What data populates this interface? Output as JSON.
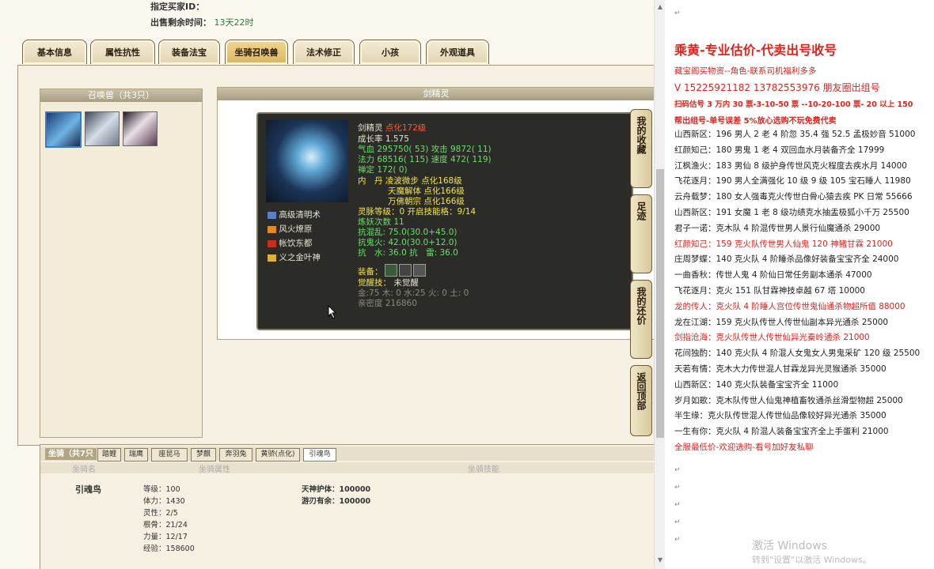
{
  "top": {
    "seller_label": "指定买家ID：",
    "time_label": "出售剩余时间：",
    "time_value": "13天22时"
  },
  "tabs": [
    "基本信息",
    "属性抗性",
    "装备法宝",
    "坐骑召唤兽",
    "法术修正",
    "小孩",
    "外观道具"
  ],
  "summon": {
    "header": "召唤兽（共3只）",
    "detail_header": "剑精灵"
  },
  "tooltip": {
    "name": "剑精灵",
    "level": "点化172级",
    "growth": "成长率 1.575",
    "hp": "气血 295750( 53) 攻击 9872( 11)",
    "mp": "法力 68516( 115) 速度 472( 119)",
    "ding": "禅定 172( 0)",
    "dan1": "内　丹 凌波微步 点化168级",
    "dan2": "天魔解体 点化166级",
    "dan3": "万佛朝宗 点化166级",
    "soul": "灵脉等级：0 开启技能格：9/14",
    "lianyao": "炼妖次数 11",
    "k1": "抗混乱: 75.0(30.0+45.0)",
    "k2": "抗鬼火: 42.0(30.0+12.0)",
    "k3": "抗　水: 36.0 抗　雷: 36.0",
    "equip": "装备：",
    "awaken_label": "觉醒技：",
    "awaken_value": "未觉醒",
    "elements": "金:75 木: 0 水:25 火: 0 土: 0",
    "intimacy": "亲密度 216860",
    "skills": [
      "高级清明术",
      "风火燎原",
      "帐饮东都",
      "义之金叶神"
    ]
  },
  "side_buttons": [
    "我的收藏",
    "足迹",
    "我的还价",
    "返回顶部"
  ],
  "mount": {
    "title": "坐骑（共7只",
    "tabs": [
      "踏鲤",
      "瑞鹰",
      "座昆马",
      "梦麒",
      "奔羽兔",
      "黄骄(点化)",
      "引魂鸟"
    ],
    "col1": "坐骑名",
    "col2": "坐骑属性",
    "col3": "坐骑技能",
    "name": "引魂鸟",
    "attrs": [
      "等级：100",
      "体力：1430",
      "灵性：2/5",
      "根骨：21/24",
      "力量：12/17",
      "经验：158600"
    ],
    "skills": [
      "天神护体：100000",
      "游刃有余：100000"
    ]
  },
  "doc": {
    "title": "乘黄-专业估价-代卖出号收号",
    "line1": "藏宝阁买物资--角色-联系司机福利多多",
    "line2": "V 15225921182   13782553976 朋友圈出组号",
    "line3": "扫码估号 3 万内 30 票-3-10-50 票  --10-20-100 票- 20 以上 150",
    "line4": "帮出组号-单号误差 5%放心选购不玩免费代卖",
    "rows": [
      {
        "t": "山西新区：196 男人 2 老 4 阶忽 35.4 强 52.5 孟极妙音 51000",
        "red": false
      },
      {
        "t": "红颜知己：180 男鬼 1 老 4 双回血水月装备齐全 17999",
        "red": false
      },
      {
        "t": "江枫渔火：183 男仙 8 级护身传世风克火程度去疾水月 14000",
        "red": false
      },
      {
        "t": "飞花逐月：190 男人全满强化 10 级 9 级 105 宝石睡人 11980",
        "red": false
      },
      {
        "t": "云舟载梦：180 女人强毒克火传世白骨心猿去疾 PK 日常 55666",
        "red": false
      },
      {
        "t": "山西新区：191 女魔 1 老 8 级功绩克水抽盂极狐小千万 25500",
        "red": false
      },
      {
        "t": "君子一诺：克木队 4 阶混传世男人景行仙魔通杀 29000",
        "red": false
      },
      {
        "t": "红颜知己：159 克火队传世男人仙鬼 120 神猪甘霖 21000",
        "red": true
      },
      {
        "t": "庄周梦蝶：140 克火队 4 阶睡杀品像好装备宝宝齐全 24000",
        "red": false
      },
      {
        "t": "一曲香秋：传世人鬼 4 阶仙日常任务副本通杀 47000",
        "red": false
      },
      {
        "t": "飞花逐月：克火 151 队甘霖神技卓越 67 塔 10000",
        "red": false
      },
      {
        "t": "龙的传人：克火队 4 阶睡人宫位传世鬼仙通杀物超所值 88000",
        "red": true
      },
      {
        "t": "龙在江湖：159 克火队传世人传世仙副本异光通杀 25000",
        "red": false
      },
      {
        "t": "剑指沧海：克火队传世人传世仙异光秦岭通杀 21000",
        "red": true
      },
      {
        "t": "花间独酌：140 克火队 4 阶混人女鬼女人男鬼采矿 120 级 25500",
        "red": false
      },
      {
        "t": "天若有情：克木大力传世混人甘霖龙异光灵猴通杀 35000",
        "red": false
      },
      {
        "t": "山西新区：140 克火队装备宝宝齐全 11000",
        "red": false
      },
      {
        "t": "岁月如歌：克木队传世人仙鬼神植畜牧通杀丝滑型物超 25000",
        "red": false
      },
      {
        "t": "半生缘：克火队传世混人传世仙品像较好异光通杀 35000",
        "red": false
      },
      {
        "t": "一生有你：克火队 4 阶混人装备宝宝齐全上手蛋利 21000",
        "red": false
      },
      {
        "t": "全服最低价-欢迎选购-看号加好友私聊",
        "red": true
      }
    ],
    "watermark1": "激活 Windows",
    "watermark2": "转到\"设置\"以激活 Windows。"
  }
}
